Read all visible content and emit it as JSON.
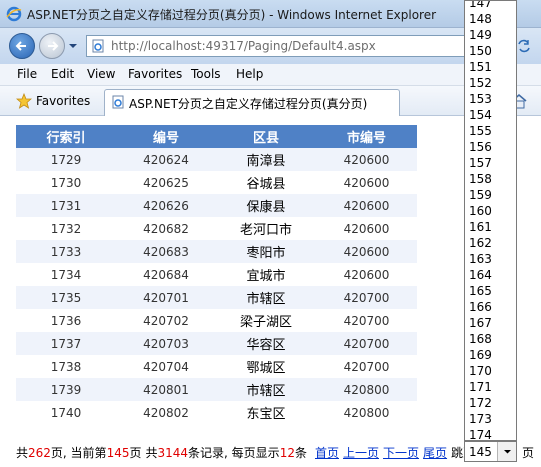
{
  "window": {
    "title": "ASP.NET分页之自定义存储过程分页(真分页) - Windows Internet Explorer"
  },
  "address_bar": {
    "url": "http://localhost:49317/Paging/Default4.aspx"
  },
  "menu": [
    "File",
    "Edit",
    "View",
    "Favorites",
    "Tools",
    "Help"
  ],
  "favorites_bar": {
    "label": "Favorites",
    "tab_title": "ASP.NET分页之自定义存储过程分页(真分页)"
  },
  "table": {
    "columns": [
      "行索引",
      "编号",
      "区县",
      "市编号"
    ],
    "rows": [
      [
        "1729",
        "420624",
        "南漳县",
        "420600"
      ],
      [
        "1730",
        "420625",
        "谷城县",
        "420600"
      ],
      [
        "1731",
        "420626",
        "保康县",
        "420600"
      ],
      [
        "1732",
        "420682",
        "老河口市",
        "420600"
      ],
      [
        "1733",
        "420683",
        "枣阳市",
        "420600"
      ],
      [
        "1734",
        "420684",
        "宜城市",
        "420600"
      ],
      [
        "1735",
        "420701",
        "市辖区",
        "420700"
      ],
      [
        "1736",
        "420702",
        "梁子湖区",
        "420700"
      ],
      [
        "1737",
        "420703",
        "华容区",
        "420700"
      ],
      [
        "1738",
        "420704",
        "鄂城区",
        "420700"
      ],
      [
        "1739",
        "420801",
        "市辖区",
        "420800"
      ],
      [
        "1740",
        "420802",
        "东宝区",
        "420800"
      ]
    ]
  },
  "pager": {
    "prefix_total": "共",
    "total_pages": "262",
    "text_pages_current": "页, 当前第",
    "current_page": "145",
    "text_page": "页",
    "text_total_records": "共",
    "total_records": "3144",
    "text_records_per_page": "条记录, 每页显示",
    "page_size": "12",
    "text_items": "条",
    "first_label": "首页",
    "prev_label": "上一页",
    "next_label": "下一页",
    "last_label": "尾页",
    "goto_label": "跳到",
    "selected_page": "145",
    "suffix": "页"
  },
  "dropdown_options": [
    "147",
    "148",
    "149",
    "150",
    "151",
    "152",
    "153",
    "154",
    "155",
    "156",
    "157",
    "158",
    "159",
    "160",
    "161",
    "162",
    "163",
    "164",
    "165",
    "166",
    "167",
    "168",
    "169",
    "170",
    "171",
    "172",
    "173",
    "174"
  ],
  "colors": {
    "header_bg": "#4f81c6",
    "alt_row_bg": "#eff3fb",
    "highlight_red": "#e00000",
    "link_blue": "#0033cc"
  }
}
